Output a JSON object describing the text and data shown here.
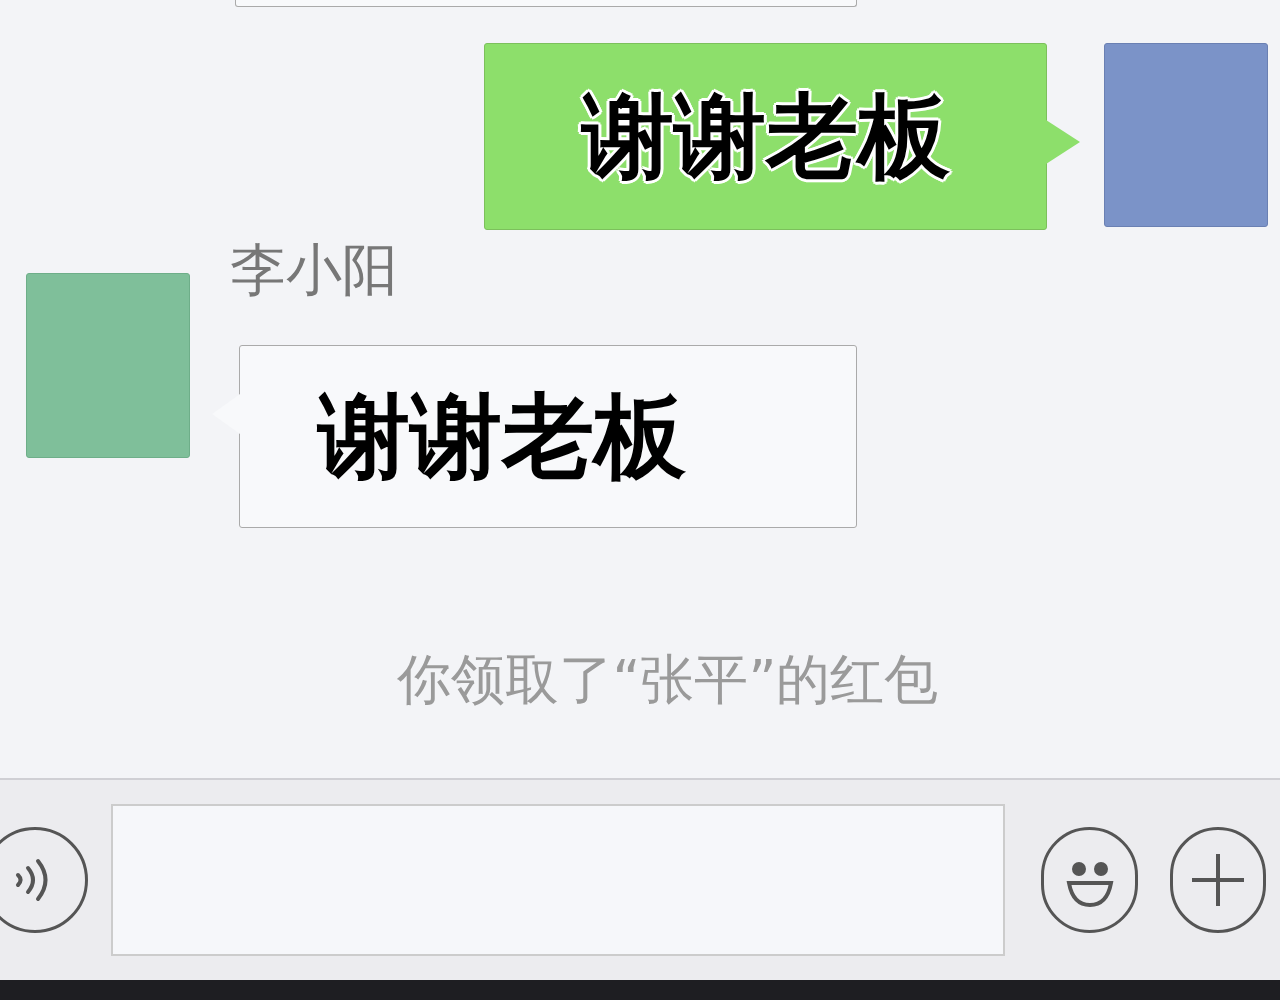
{
  "messages": [
    {
      "kind": "outgoing",
      "text": "谢谢老板"
    },
    {
      "kind": "incoming",
      "sender": "李小阳",
      "text": "谢谢老板"
    },
    {
      "kind": "system",
      "text": "你领取了“张平”的红包"
    }
  ]
}
